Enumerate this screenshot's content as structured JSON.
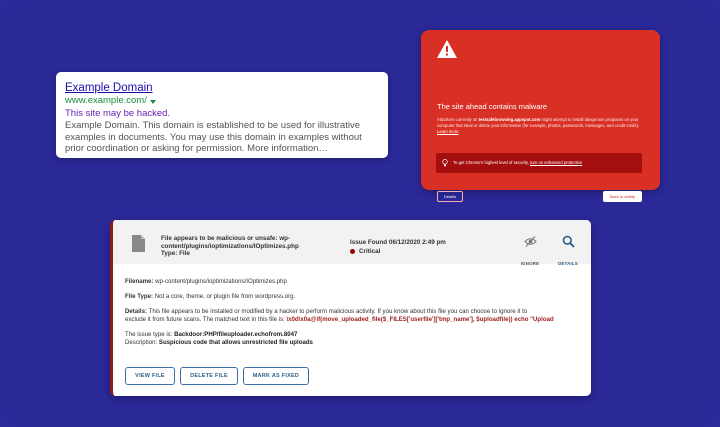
{
  "colors": {
    "background": "#2b2898",
    "warning_red": "#d93025",
    "critical": "#930000",
    "link_blue": "#1a0dab",
    "url_green": "#1a8f3a",
    "hacked_purple": "#6a1fb5",
    "wordfence_blue": "#2c5e86"
  },
  "search_result": {
    "title": "Example Domain",
    "url": "www.example.com/",
    "url_icon": "caret-down-icon",
    "warning": "This site may be hacked.",
    "description": "Example Domain. This domain is established to be used for illustrative examples in documents. You may use this domain in examples without prior coordination or asking for permission. More information…"
  },
  "malware_warning": {
    "icon": "warning-triangle-icon",
    "title": "The site ahead contains malware",
    "desc_prefix": "Attackers currently on ",
    "desc_site": "testsafebrowsing.appspot.com",
    "desc_body": " might attempt to install dangerous programs on your computer that steal or delete your information (for example, photos, passwords, messages, and credit cards). ",
    "desc_link": "Learn more",
    "protection_icon": "lightbulb-icon",
    "protection_text": "To get Chrome's highest level of security, ",
    "protection_link": "turn on enhanced protection",
    "details_label": "Details",
    "back_label": "Back to safety"
  },
  "issue": {
    "file_icon": "file-icon",
    "title_line1": "File appears to be malicious or unsafe: wp-",
    "title_line2": "content/plugins/ioptimizations/IOptimizes.php",
    "type_line": "Type: File",
    "found": "Issue Found 06/12/2020 2:49 pm",
    "severity": "Critical",
    "ignore_label": "IGNORE",
    "details_label": "DETAILS",
    "filename_label": "Filename:",
    "filename_value": " wp-content/plugins/ioptimizations/IOptimizes.php",
    "filetype_label": "File Type:",
    "filetype_value": " Not a core, theme, or plugin file from wordpress.org.",
    "details_text_label": "Details:",
    "details_text_1": " This file appears to be installed or modified by a hacker to perform malicious activity. If you know about this file you can choose to ignore it to",
    "details_text_2": "exclude it from future scans. The matched text in this file is: ",
    "details_code": "\\x0d\\x0a@if(move_uploaded_file($_FILES['userfile']['tmp_name'], $uploadfile)) echo \"Upload",
    "issue_type_label": "The issue type is: ",
    "issue_type_value": "Backdoor:PHP/fileuploader.echofrom.8047",
    "description_label": "Description: ",
    "description_value": "Suspicious code that allows unrestricted file uploads",
    "buttons": {
      "view": "VIEW FILE",
      "delete": "DELETE FILE",
      "fixed": "MARK AS FIXED"
    }
  }
}
